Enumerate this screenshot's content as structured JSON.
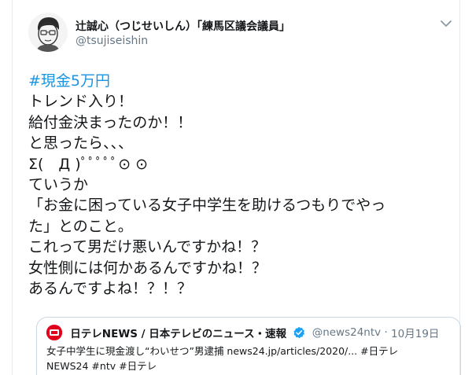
{
  "tweet": {
    "display_name": "辻誠心（つじせいしん）「練馬区議会議員」",
    "handle": "@tsujiseishin",
    "hashtag": "#現金5万円",
    "lines": [
      "トレンド入り！",
      "給付金決まったのか！！",
      "と思ったら、、、",
      "Σ(　Д )ﾟﾟﾟﾟﾟ⊙ ⊙",
      "ていうか",
      "「お金に困っている女子中学生を助けるつもりでやっ",
      "た」とのこと。",
      "これって男だけ悪いんですかね！？",
      "女性側には何かあるんですかね！？",
      "あるんですよね！？！？"
    ]
  },
  "quoted": {
    "name": "日テレNEWS / 日本テレビのニュース・速報",
    "handle": "@news24ntv",
    "separator": "·",
    "date": "10月19日",
    "text_line1": "女子中学生に現金渡し“わいせつ”男逮捕 news24.jp/articles/2020/... #日テレ",
    "text_line2": "NEWS24 #ntv #日テレ"
  },
  "icons": {
    "avatar": "avatar-sketch-icon",
    "menu": "chevron-down-icon",
    "verified": "verified-badge-icon",
    "logo": "ntv-logo-icon"
  },
  "colors": {
    "hashtag": "#1b95e0",
    "muted": "#657786",
    "verified": "#1da1f2",
    "ntv_red": "#e0001b"
  }
}
